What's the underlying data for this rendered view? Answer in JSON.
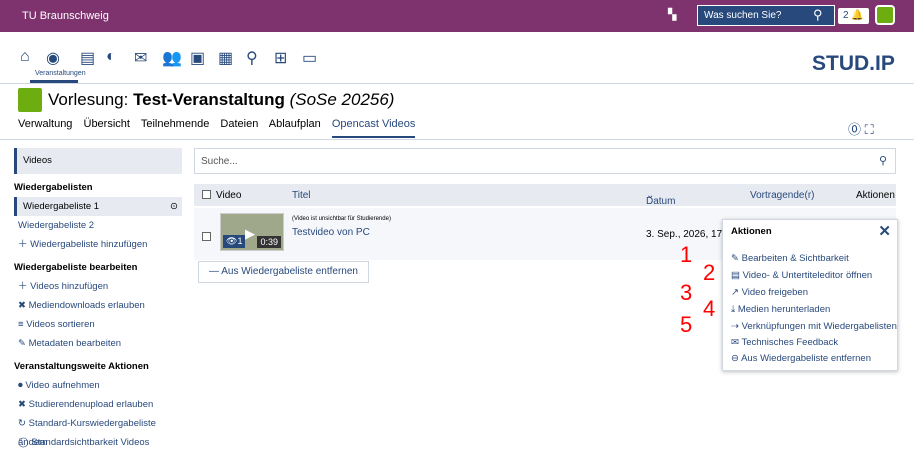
{
  "topbar": {
    "org": "TU Braunschweig",
    "search_placeholder": "Was suchen Sie?",
    "notif_count": "2"
  },
  "nav": {
    "active_label": "Veranstaltungen"
  },
  "logo": "STUD.IP",
  "context": {
    "prefix": "Vorlesung: ",
    "title": "Test-Veranstaltung",
    "semester": " (SoSe 20256)"
  },
  "tabs": [
    "Verwaltung",
    "Übersicht",
    "Teilnehmende",
    "Dateien",
    "Ablaufplan",
    "Opencast Videos"
  ],
  "sidebar": {
    "videos": "Videos",
    "playlists_head": "Wiedergabelisten",
    "playlist1": "Wiedergabeliste 1",
    "playlist2": "Wiedergabeliste 2",
    "add_playlist": "Wiedergabeliste hinzufügen",
    "edit_head": "Wiedergabeliste bearbeiten",
    "edit_items": [
      "Videos hinzufügen",
      "Mediendownloads erlauben",
      "Videos sortieren",
      "Metadaten bearbeiten"
    ],
    "course_head": "Veranstaltungsweite Aktionen",
    "course_items": [
      "Video aufnehmen",
      "Studierendenupload erlauben",
      "Standard-Kurswiedergabeliste ändern",
      "Standardsichtbarkeit Videos"
    ]
  },
  "main": {
    "search_placeholder": "Suche...",
    "headers": {
      "video": "Video",
      "title": "Titel",
      "date": "Datum",
      "speaker": "Vortragende(r)",
      "actions": "Aktionen"
    },
    "row": {
      "note": "(Video ist unsichtbar für Studierende)",
      "title": "Testvideo von PC",
      "date": "3. Sep., 2026, 17:00 U",
      "views": "1",
      "duration": "0:39"
    },
    "remove_btn": "Aus Wiedergabeliste entfernen"
  },
  "menu": {
    "title": "Aktionen",
    "items": [
      "Bearbeiten & Sichtbarkeit",
      "Video- & Untertiteleditor öffnen",
      "Video freigeben",
      "Medien herunterladen",
      "Verknüpfungen mit Wiedergabelisten",
      "Technisches Feedback",
      "Aus Wiedergabeliste entfernen"
    ]
  },
  "annotations": [
    "1",
    "2",
    "3",
    "4",
    "5"
  ]
}
